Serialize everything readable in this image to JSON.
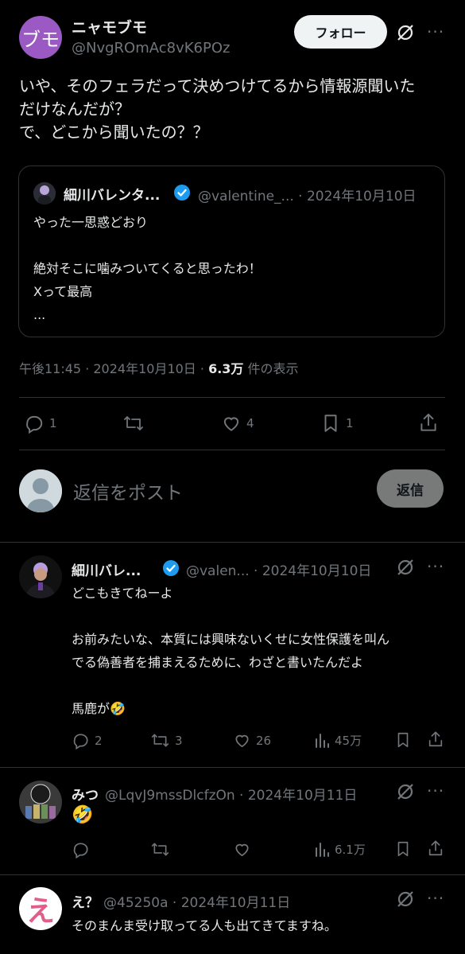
{
  "post": {
    "avatar_text": "ブモ",
    "author_name": "ニャモブモ",
    "author_handle": "@NvgROmAc8vK6POz",
    "follow_label": "フォロー",
    "more": "···",
    "body_lines": [
      "いや、そのフェラだって決めつけてるから情報源聞いた",
      "だけなんだが？",
      "で、どこから聞いたの？？"
    ],
    "quote": {
      "name": "細川バレンタ...",
      "handle_date": "@valentine_... · 2024年10月10日",
      "lines": [
        "やった一思惑どおり",
        "",
        "絶対そこに噛みついてくると思ったわ！",
        "Xって最高",
        "..."
      ]
    },
    "time": "午後11:45 · 2024年10月10日 · ",
    "views_count": "6.3万",
    "views_label": " 件の表示",
    "stats": {
      "replies": "1",
      "reposts": "",
      "likes": "4",
      "bookmarks": "1"
    }
  },
  "composer": {
    "placeholder": "返信をポスト",
    "reply_label": "返信"
  },
  "replies": [
    {
      "name": "細川バレ...",
      "meta": "@valen... · 2024年10月10日",
      "lines": [
        "どこもきてねーよ",
        "",
        "お前みたいな、本質には興味ないくせに女性保護を叫ん",
        "でる偽善者を捕まえるために、わざと書いたんだよ",
        "",
        "馬鹿が🤣"
      ],
      "replies": "2",
      "reposts": "3",
      "likes": "26",
      "views": "45万"
    },
    {
      "name": "みつ",
      "meta": "@LqvJ9mssDlcfzOn · 2024年10月11日",
      "lines": [
        "🤣"
      ],
      "replies": "",
      "reposts": "",
      "likes": "",
      "views": "6.1万"
    },
    {
      "name": "え？",
      "meta": "@45250a · 2024年10月11日",
      "avatar_text": "え",
      "lines": [
        "そのまんま受け取ってる人も出てきてますね。"
      ]
    }
  ],
  "icons": {
    "grok": "grok-icon",
    "more": "more-icon",
    "reply": "reply-icon",
    "repost": "repost-icon",
    "like": "heart-icon",
    "bookmark": "bookmark-icon",
    "share": "share-icon",
    "views": "views-icon",
    "verified": "verified-badge-icon"
  },
  "colors": {
    "background": "#000000",
    "text": "#e7e9ea",
    "muted": "#71767b",
    "verified": "#1d9bf0",
    "avatar_main": "#9b59c4",
    "divider": "#2f3336"
  }
}
